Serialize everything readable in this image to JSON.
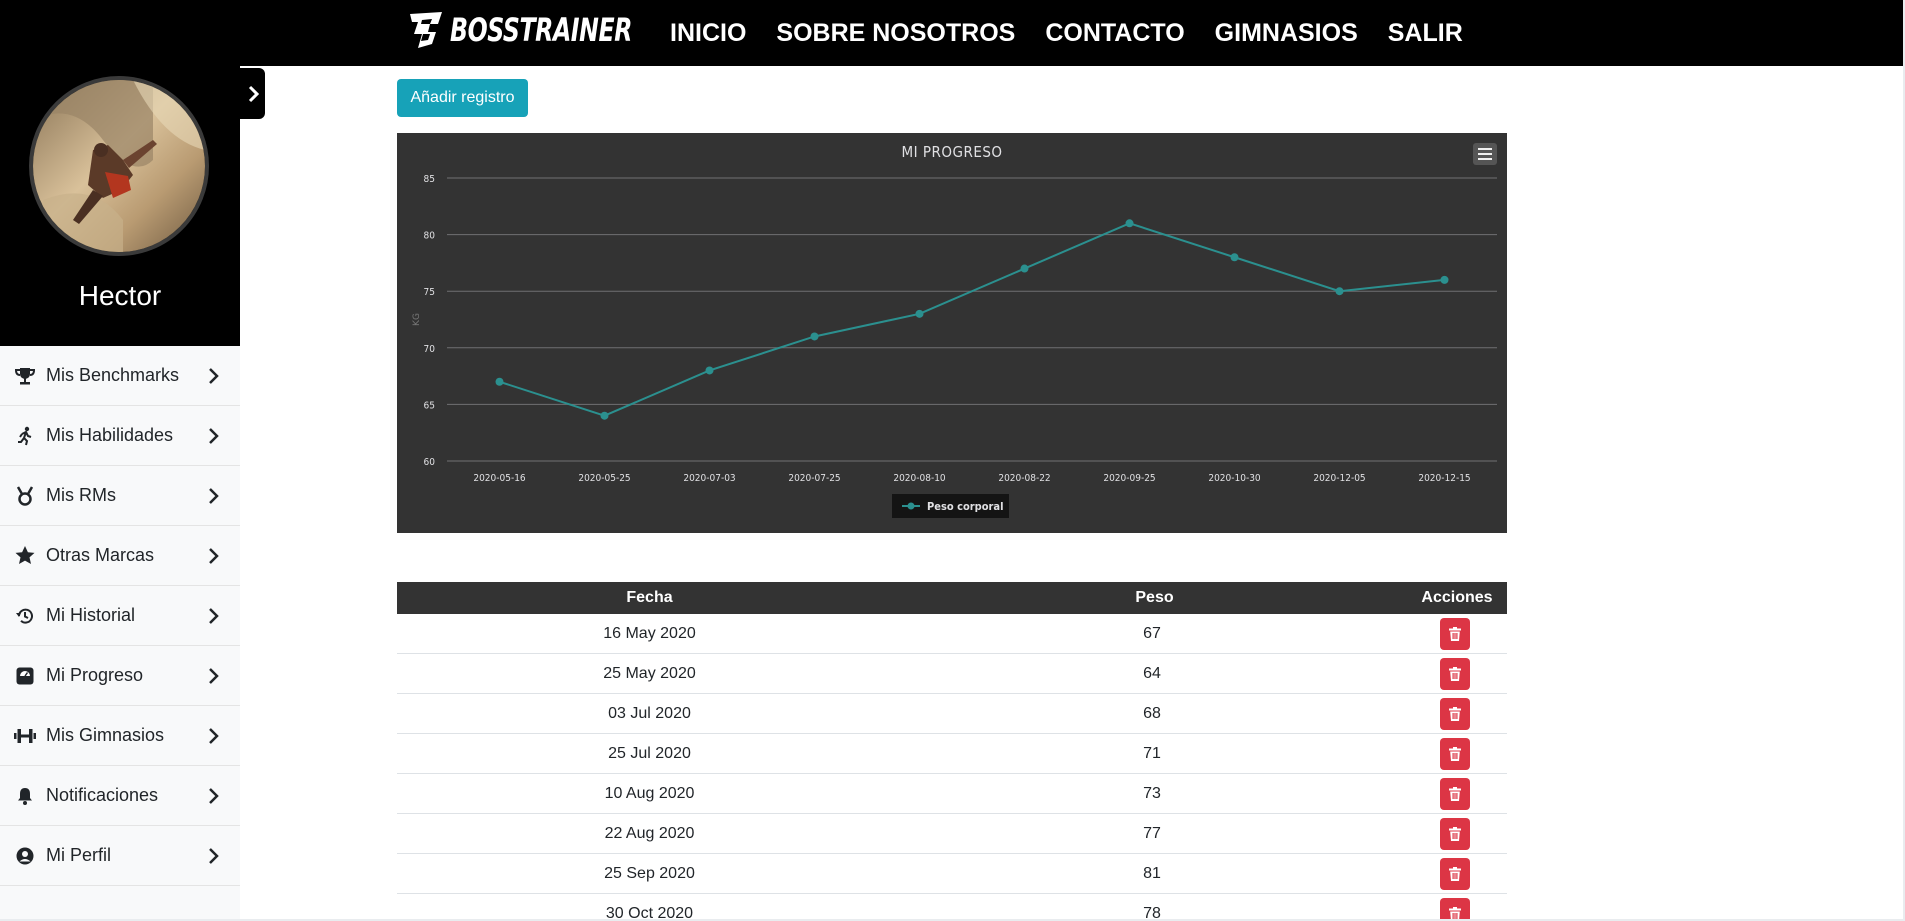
{
  "brand": {
    "name": "BOSSTRAINER"
  },
  "nav": [
    "INICIO",
    "SOBRE NOSOTROS",
    "CONTACTO",
    "GIMNASIOS",
    "SALIR"
  ],
  "profile": {
    "name": "Hector"
  },
  "menu": [
    {
      "label": "Mis Benchmarks",
      "icon": "trophy-icon"
    },
    {
      "label": "Mis Habilidades",
      "icon": "running-icon"
    },
    {
      "label": "Mis RMs",
      "icon": "medal-icon"
    },
    {
      "label": "Otras Marcas",
      "icon": "star-icon"
    },
    {
      "label": "Mi Historial",
      "icon": "history-icon"
    },
    {
      "label": "Mi Progreso",
      "icon": "weight-scale-icon"
    },
    {
      "label": "Mis Gimnasios",
      "icon": "dumbbell-icon"
    },
    {
      "label": "Notificaciones",
      "icon": "bell-icon"
    },
    {
      "label": "Mi Perfil",
      "icon": "user-circle-icon"
    }
  ],
  "actions": {
    "add_label": "Añadir registro"
  },
  "chart_data": {
    "type": "line",
    "title": "MI PROGRESO",
    "ylabel": "KG",
    "xlabel": "",
    "categories": [
      "2020-05-16",
      "2020-05-25",
      "2020-07-03",
      "2020-07-25",
      "2020-08-10",
      "2020-08-22",
      "2020-09-25",
      "2020-10-30",
      "2020-12-05",
      "2020-12-15"
    ],
    "series": [
      {
        "name": "Peso corporal",
        "values": [
          67,
          64,
          68,
          71,
          73,
          77,
          81,
          78,
          75,
          76
        ]
      }
    ],
    "ylim": [
      60,
      85
    ],
    "yticks": [
      60,
      65,
      70,
      75,
      80,
      85
    ],
    "grid": true,
    "legend": "bottom-center",
    "colors": {
      "background": "#333333",
      "line": "#2b908f",
      "grid": "#707073",
      "text": "#e0e0e3"
    }
  },
  "table": {
    "headers": [
      "Fecha",
      "Peso",
      "Acciones"
    ],
    "rows": [
      {
        "fecha": "16 May 2020",
        "peso": "67"
      },
      {
        "fecha": "25 May 2020",
        "peso": "64"
      },
      {
        "fecha": "03 Jul 2020",
        "peso": "68"
      },
      {
        "fecha": "25 Jul 2020",
        "peso": "71"
      },
      {
        "fecha": "10 Aug 2020",
        "peso": "73"
      },
      {
        "fecha": "22 Aug 2020",
        "peso": "77"
      },
      {
        "fecha": "25 Sep 2020",
        "peso": "81"
      },
      {
        "fecha": "30 Oct 2020",
        "peso": "78"
      }
    ]
  },
  "colors": {
    "accent": "#17a2b8",
    "danger": "#dc3545",
    "dark": "#000000",
    "sidebar_bg": "#f8f9fa"
  }
}
